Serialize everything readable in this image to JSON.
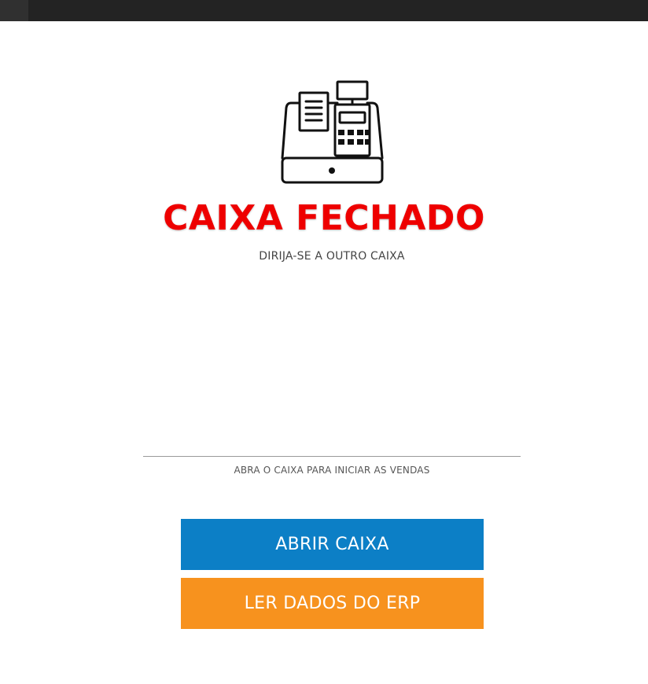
{
  "status": {
    "title": "CAIXA FECHADO",
    "subtitle": "DIRIJA-SE A OUTRO CAIXA",
    "hint": "ABRA O CAIXA PARA INICIAR AS VENDAS",
    "title_color": "#ee0000"
  },
  "icon": {
    "name": "cash-register-icon"
  },
  "actions": {
    "open_label": "ABRIR CAIXA",
    "open_color": "#0c7fc6",
    "erp_label": "LER DADOS DO ERP",
    "erp_color": "#f7921e"
  }
}
